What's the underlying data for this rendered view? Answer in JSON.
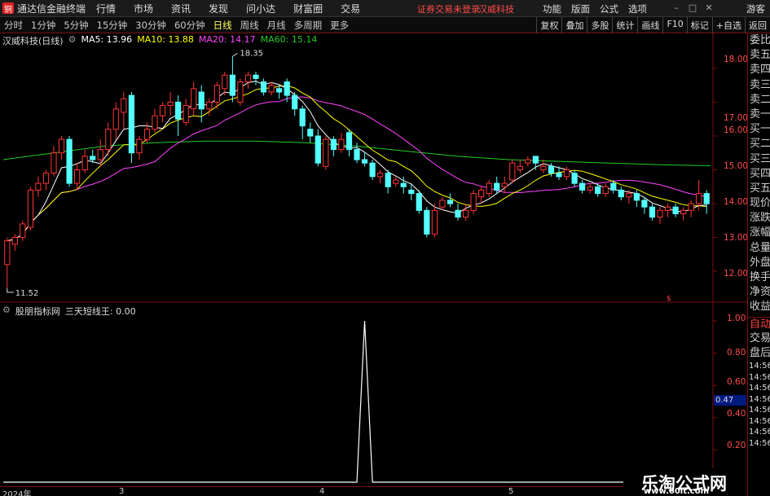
{
  "app": {
    "title": "通达信金融终端",
    "logo": "铜"
  },
  "menu": [
    "行情",
    "市场",
    "资讯",
    "发现",
    "问小达",
    "财富圈",
    "交易"
  ],
  "status_text": "证券交易未登录",
  "stock_name": "汉威科技",
  "right_menu": [
    "功能",
    "版面",
    "公式",
    "选项"
  ],
  "guest_label": "游客",
  "periods": [
    "分时",
    "1分钟",
    "5分钟",
    "15分钟",
    "30分钟",
    "60分钟",
    "日线",
    "周线",
    "月线",
    "多周期",
    "更多"
  ],
  "active_period": "日线",
  "toolbar_right": [
    "复权",
    "叠加",
    "多股",
    "统计",
    "画线",
    "F10",
    "标记",
    "+自选",
    "返回"
  ],
  "chart_header": {
    "stock": "汉威科技(日线)",
    "ma": [
      {
        "label": "MA5: 13.96",
        "color": "#ffffff"
      },
      {
        "label": "MA10: 13.88",
        "color": "#ffff00"
      },
      {
        "label": "MA20: 14.17",
        "color": "#ff44ff"
      },
      {
        "label": "MA60: 15.14",
        "color": "#22cc22"
      }
    ]
  },
  "sub_header": {
    "name": "股朋指标网",
    "series": "三天短线王: 0.00"
  },
  "side_panel": {
    "items": [
      "委比",
      "卖五",
      "卖四",
      "卖三",
      "卖二",
      "卖一",
      "买一",
      "买二",
      "买三",
      "买四",
      "买五",
      "现价",
      "涨跌",
      "涨幅",
      "总量",
      "外盘",
      "换手",
      "净资",
      "收益"
    ],
    "auto_label": "自动",
    "lower_items": [
      "交易",
      "盘后"
    ],
    "times": [
      "14:56",
      "14:56",
      "14:56",
      "14:56",
      "14:56",
      "14:56",
      "14:56",
      "14:56"
    ]
  },
  "price_axis": [
    "18.00",
    "17.00",
    "16.00",
    "15.00",
    "14.00",
    "13.00",
    "12.00"
  ],
  "sub_axis": [
    "1.00",
    "0.80",
    "0.60",
    "0.40",
    "0.20"
  ],
  "cursor_value": "0.47",
  "dates": [
    "2024年",
    "3",
    "4",
    "5"
  ],
  "annotations": {
    "high": "18.35",
    "low": "11.52"
  },
  "colors": {
    "up": "#ff3333",
    "down": "#54ffff",
    "ma5": "#ffffff",
    "ma10": "#ffff00",
    "ma20": "#ff44ff",
    "ma60": "#22cc22",
    "axis": "#7a1010"
  },
  "watermark": {
    "title": "乐淘公式网",
    "url": "www.60lt.com"
  },
  "chart_data": {
    "type": "candlestick",
    "price_range": [
      11.4,
      18.6
    ],
    "candles": [
      [
        12.2,
        12.9,
        11.5,
        13.0
      ],
      [
        12.8,
        13.0,
        12.6,
        13.1
      ],
      [
        13.0,
        13.4,
        12.9,
        13.5
      ],
      [
        13.3,
        14.4,
        13.2,
        14.5
      ],
      [
        14.4,
        14.6,
        14.2,
        14.8
      ],
      [
        14.6,
        14.9,
        14.4,
        15.0
      ],
      [
        14.9,
        15.5,
        14.8,
        15.7
      ],
      [
        15.5,
        15.9,
        15.3,
        16.0
      ],
      [
        15.9,
        14.6,
        14.5,
        16.0
      ],
      [
        14.6,
        15.0,
        14.4,
        15.2
      ],
      [
        15.0,
        15.4,
        14.9,
        15.6
      ],
      [
        15.4,
        15.3,
        15.2,
        15.6
      ],
      [
        15.3,
        15.6,
        15.1,
        15.9
      ],
      [
        15.6,
        16.2,
        15.4,
        16.4
      ],
      [
        16.2,
        16.8,
        15.9,
        17.0
      ],
      [
        16.7,
        17.1,
        16.2,
        17.3
      ],
      [
        17.2,
        15.5,
        15.2,
        17.3
      ],
      [
        15.5,
        15.9,
        15.3,
        16.0
      ],
      [
        15.9,
        16.2,
        15.8,
        16.4
      ],
      [
        16.2,
        16.6,
        16.1,
        16.8
      ],
      [
        16.6,
        16.9,
        16.4,
        17.0
      ],
      [
        16.9,
        17.0,
        16.6,
        17.3
      ],
      [
        17.0,
        16.5,
        16.0,
        17.2
      ],
      [
        16.4,
        16.9,
        16.3,
        17.1
      ],
      [
        16.8,
        17.4,
        16.6,
        17.6
      ],
      [
        17.3,
        16.8,
        16.4,
        17.5
      ],
      [
        16.8,
        17.0,
        16.6,
        17.1
      ],
      [
        17.0,
        17.5,
        16.8,
        17.6
      ],
      [
        17.4,
        17.8,
        17.2,
        17.9
      ],
      [
        17.8,
        17.2,
        17.0,
        18.35
      ],
      [
        17.0,
        17.6,
        16.9,
        17.7
      ],
      [
        17.6,
        17.8,
        17.4,
        17.9
      ],
      [
        17.8,
        17.7,
        17.5,
        17.9
      ],
      [
        17.6,
        17.3,
        17.2,
        17.7
      ],
      [
        17.3,
        17.5,
        17.2,
        17.6
      ],
      [
        17.4,
        17.3,
        17.1,
        17.5
      ],
      [
        17.6,
        17.2,
        17.0,
        17.7
      ],
      [
        17.2,
        16.8,
        16.6,
        17.3
      ],
      [
        16.8,
        16.3,
        15.9,
        16.9
      ],
      [
        16.2,
        16.0,
        15.8,
        16.4
      ],
      [
        16.0,
        15.2,
        15.1,
        16.2
      ],
      [
        15.1,
        15.9,
        15.0,
        16.0
      ],
      [
        15.9,
        15.6,
        15.4,
        16.0
      ],
      [
        15.6,
        15.9,
        15.5,
        16.1
      ],
      [
        16.1,
        15.6,
        15.4,
        16.2
      ],
      [
        15.6,
        15.3,
        15.2,
        15.8
      ],
      [
        15.3,
        15.2,
        15.1,
        15.5
      ],
      [
        15.2,
        14.8,
        14.7,
        15.3
      ],
      [
        14.8,
        14.9,
        14.6,
        15.0
      ],
      [
        14.9,
        14.5,
        14.3,
        15.0
      ],
      [
        14.6,
        14.7,
        14.5,
        14.8
      ],
      [
        14.6,
        14.5,
        14.3,
        14.8
      ],
      [
        14.4,
        14.3,
        14.1,
        14.6
      ],
      [
        14.3,
        13.8,
        13.7,
        14.4
      ],
      [
        13.8,
        13.1,
        13.0,
        13.9
      ],
      [
        13.1,
        13.8,
        13.0,
        14.0
      ],
      [
        13.9,
        14.1,
        13.8,
        14.2
      ],
      [
        14.1,
        14.0,
        13.9,
        14.3
      ],
      [
        13.8,
        13.6,
        13.5,
        14.0
      ],
      [
        13.6,
        13.8,
        13.5,
        14.0
      ],
      [
        13.8,
        14.3,
        13.7,
        14.4
      ],
      [
        14.2,
        14.4,
        14.0,
        14.5
      ],
      [
        14.3,
        14.6,
        14.2,
        14.7
      ],
      [
        14.6,
        14.4,
        14.3,
        14.8
      ],
      [
        14.5,
        14.6,
        14.3,
        14.8
      ],
      [
        14.7,
        15.2,
        14.6,
        15.3
      ],
      [
        15.0,
        15.1,
        14.9,
        15.3
      ],
      [
        15.2,
        15.3,
        15.1,
        15.4
      ],
      [
        15.4,
        15.2,
        15.0,
        15.4
      ],
      [
        15.0,
        15.1,
        14.9,
        15.3
      ],
      [
        15.1,
        14.9,
        14.8,
        15.2
      ],
      [
        14.9,
        14.8,
        14.7,
        15.1
      ],
      [
        14.8,
        15.0,
        14.7,
        15.1
      ],
      [
        14.9,
        14.6,
        14.5,
        15.0
      ],
      [
        14.6,
        14.4,
        14.3,
        14.7
      ],
      [
        14.4,
        14.5,
        14.3,
        14.6
      ],
      [
        14.5,
        14.3,
        14.2,
        14.6
      ],
      [
        14.3,
        14.5,
        14.2,
        14.6
      ],
      [
        14.6,
        14.4,
        14.3,
        14.7
      ],
      [
        14.4,
        14.2,
        14.1,
        14.5
      ],
      [
        14.2,
        14.3,
        14.0,
        14.4
      ],
      [
        14.3,
        14.1,
        13.9,
        14.4
      ],
      [
        14.1,
        13.9,
        13.7,
        14.2
      ],
      [
        13.9,
        13.6,
        13.5,
        14.0
      ],
      [
        13.6,
        13.8,
        13.4,
        13.9
      ],
      [
        13.8,
        13.9,
        13.6,
        14.0
      ],
      [
        13.9,
        13.7,
        13.6,
        14.0
      ],
      [
        13.7,
        13.8,
        13.5,
        13.9
      ],
      [
        13.8,
        14.0,
        13.6,
        14.1
      ],
      [
        14.0,
        14.3,
        13.8,
        14.7
      ],
      [
        14.3,
        14.0,
        13.7,
        14.4
      ]
    ],
    "ma60": [
      15.3,
      15.5,
      15.7,
      15.8,
      15.85,
      15.85,
      15.8,
      15.7,
      15.55,
      15.4,
      15.3,
      15.25,
      15.2,
      15.15,
      15.12
    ],
    "indicator": {
      "name": "三天短线王",
      "ylim": [
        0,
        1
      ],
      "signal_index": 46,
      "signal_value": 1.0
    }
  }
}
